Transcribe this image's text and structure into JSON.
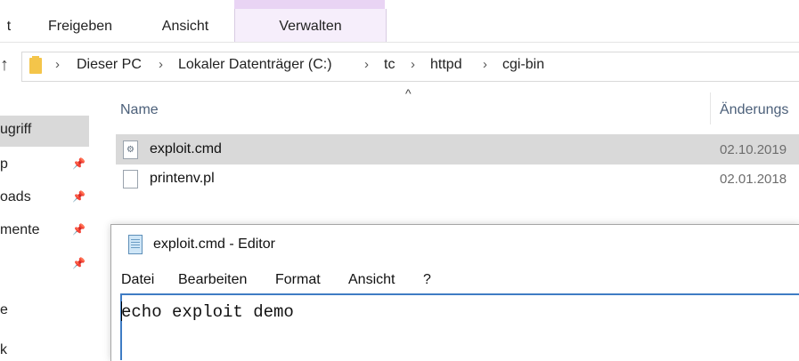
{
  "ribbon": {
    "tabs": [
      {
        "label": "t"
      },
      {
        "label": "Freigeben"
      },
      {
        "label": "Ansicht"
      },
      {
        "label": "Verwalten"
      }
    ]
  },
  "address_bar": {
    "breadcrumbs": [
      "Dieser PC",
      "Lokaler Datenträger (C:)",
      "tc",
      "httpd",
      "cgi-bin"
    ]
  },
  "nav": {
    "items": [
      {
        "label": "ugriff"
      },
      {
        "label": "p"
      },
      {
        "label": "oads"
      },
      {
        "label": "mente"
      },
      {
        "label": "e"
      },
      {
        "label": "k"
      }
    ]
  },
  "file_list": {
    "columns": {
      "name": "Name",
      "date": "Änderungs"
    },
    "sort_indicator": "^",
    "files": [
      {
        "name": "exploit.cmd",
        "date": "02.10.2019",
        "icon": "cmd-file-icon",
        "selected": true
      },
      {
        "name": "printenv.pl",
        "date": "02.01.2018",
        "icon": "file-icon",
        "selected": false
      }
    ]
  },
  "editor": {
    "title": "exploit.cmd - Editor",
    "menu": [
      "Datei",
      "Bearbeiten",
      "Format",
      "Ansicht",
      "?"
    ],
    "content": "echo exploit demo"
  },
  "colors": {
    "ribbon_manage_tab": "#f6eefb",
    "selection": "#d9d9d9",
    "text_focus_border": "#3f7cc4"
  }
}
